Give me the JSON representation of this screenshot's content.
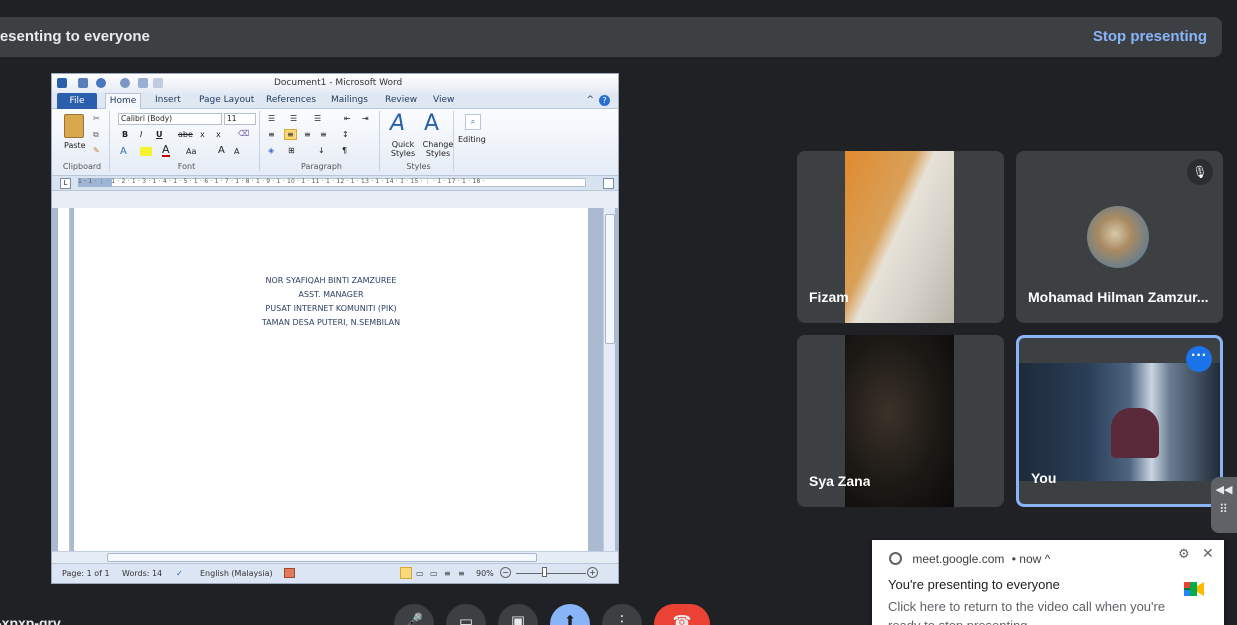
{
  "banner": {
    "text": "resenting to everyone",
    "stop_label": "Stop presenting"
  },
  "word": {
    "window_title": "Document1 - Microsoft Word",
    "tabs": [
      "File",
      "Home",
      "Insert",
      "Page Layout",
      "References",
      "Mailings",
      "Review",
      "View"
    ],
    "ribbon": {
      "paste_label": "Paste",
      "font_name": "Calibri (Body)",
      "font_size": "11",
      "groups": [
        "Clipboard",
        "Font",
        "Paragraph",
        "Styles"
      ],
      "quick_styles": "Quick Styles",
      "change_styles": "Change Styles",
      "editing": "Editing",
      "bold": "B",
      "italic": "I",
      "underline": "U",
      "strike": "abe",
      "sub": "x",
      "sup": "x",
      "case": "Aa",
      "grow": "A",
      "shrink": "A",
      "pilcrow": "¶"
    },
    "ruler_numbers": "1 · 1 · ⋮ · 1 · 2 · 1 · 3 · 1 · 4 · 1 · 5 · 1 · 6 · 1 · 7 · 1 · 8 · 1 · 9 · 1 · 10 · 1 · 11 · 1 · 12 · 1 · 13 · 1 · 14 · 1 · 15 · ⋮ · 1 · 17 · 1 · 18 ·",
    "document_lines": [
      "NOR SYAFIQAH BINTI ZAMZUREE",
      "ASST. MANAGER",
      "PUSAT INTERNET  KOMUNITI (PIK)",
      "TAMAN DESA PUTERI, N.SEMBILAN"
    ],
    "status": {
      "page": "Page: 1 of 1",
      "words": "Words: 14",
      "language": "English (Malaysia)",
      "zoom": "90%"
    }
  },
  "participants": [
    {
      "name": "Fizam"
    },
    {
      "name": "Mohamad Hilman Zamzur..."
    },
    {
      "name": "Sya Zana"
    },
    {
      "name": "You"
    }
  ],
  "meeting_code": "-xpxp-qrv",
  "notification": {
    "source": "meet.google.com",
    "time": "• now ^",
    "title": "You're presenting to everyone",
    "body": "Click here to return to the video call when you're ready to stop presenting"
  },
  "colors": {
    "background": "#202124",
    "accent": "#8ab4f8",
    "end_call": "#ea4335",
    "present_active": "#8ab4f8"
  }
}
